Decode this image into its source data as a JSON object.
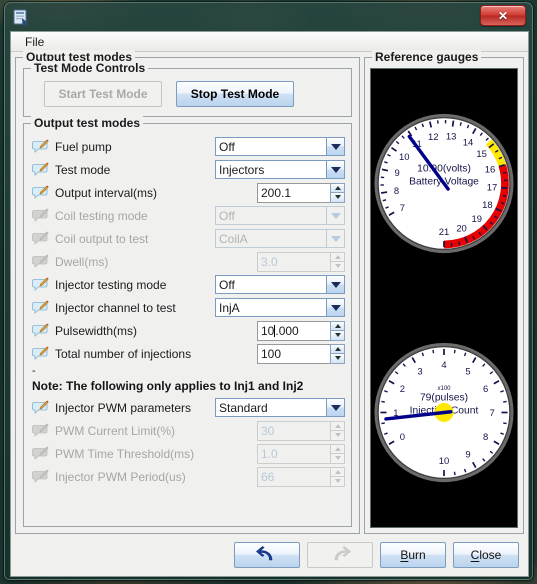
{
  "window": {
    "icon": "app-icon",
    "close_label": "✕"
  },
  "menubar": {
    "items": [
      {
        "label": "File"
      }
    ]
  },
  "outer_group": {
    "title": "Output test modes"
  },
  "controls_group": {
    "title": "Test Mode Controls",
    "start_label": "Start Test Mode",
    "stop_label": "Stop Test Mode"
  },
  "modes_group": {
    "title": "Output test modes",
    "rows": [
      {
        "icon": "edit-callout-icon",
        "label": "Fuel pump",
        "control": "combo",
        "value": "Off",
        "enabled": true
      },
      {
        "icon": "edit-callout-icon",
        "label": "Test mode",
        "control": "combo",
        "value": "Injectors",
        "enabled": true
      },
      {
        "icon": "edit-callout-icon",
        "label": "Output interval(ms)",
        "control": "spin",
        "value": "200.1",
        "enabled": true
      },
      {
        "icon": "edit-callout-icon",
        "label": "Coil testing mode",
        "control": "combo",
        "value": "Off",
        "enabled": false
      },
      {
        "icon": "edit-callout-icon",
        "label": "Coil output to test",
        "control": "combo",
        "value": "CoilA",
        "enabled": false
      },
      {
        "icon": "edit-callout-icon",
        "label": "Dwell(ms)",
        "control": "spin",
        "value": "3.0",
        "enabled": false
      },
      {
        "icon": "edit-callout-icon",
        "label": "Injector testing mode",
        "control": "combo",
        "value": "Off",
        "enabled": true
      },
      {
        "icon": "edit-callout-icon",
        "label": "Injector channel to test",
        "control": "combo",
        "value": "InjA",
        "enabled": true
      },
      {
        "icon": "edit-callout-icon",
        "label": "Pulsewidth(ms)",
        "control": "spin",
        "value": "10.000",
        "enabled": true,
        "caret_after": 2
      },
      {
        "icon": "edit-callout-icon",
        "label": "Total number of injections",
        "control": "spin",
        "value": "100",
        "enabled": true
      }
    ],
    "separator": "-",
    "note": "Note: The following only applies to Inj1 and Inj2",
    "pwm_rows": [
      {
        "icon": "edit-callout-icon",
        "label": "Injector PWM parameters",
        "control": "combo",
        "value": "Standard",
        "enabled": true
      },
      {
        "icon": "edit-callout-icon",
        "label": "PWM Current Limit(%)",
        "control": "spin",
        "value": "30",
        "enabled": false
      },
      {
        "icon": "edit-callout-icon",
        "label": "PWM Time Threshold(ms)",
        "control": "spin",
        "value": "1.0",
        "enabled": false
      },
      {
        "icon": "edit-callout-icon",
        "label": "Injector PWM Period(us)",
        "control": "spin",
        "value": "66",
        "enabled": false
      }
    ]
  },
  "gauges_group": {
    "title": "Reference gauges"
  },
  "chart_data": [
    {
      "type": "gauge",
      "name": "battery-voltage-gauge",
      "title": "Battery Voltage",
      "value_label": "10.90(volts)",
      "value": 10.9,
      "unit": "volts",
      "min": 7,
      "max": 21,
      "major_ticks": [
        7,
        8,
        9,
        10,
        11,
        12,
        13,
        14,
        15,
        16,
        17,
        18,
        19,
        20,
        21
      ],
      "minor_per_major": 2,
      "bands": [
        {
          "from": 14.8,
          "to": 16.0,
          "color": "#ffe800"
        },
        {
          "from": 16.0,
          "to": 21.0,
          "color": "#e60000"
        }
      ],
      "needle_color": "#00008b",
      "face_color": "#ffffff",
      "bezel_color": "#6b6b6b",
      "background": "#000000",
      "start_angle_deg": 210,
      "sweep_deg": 300
    },
    {
      "type": "gauge",
      "name": "injection-count-gauge",
      "title": "Injection Count",
      "value_label": "79(pulses)",
      "multiplier_label": "x100",
      "value": 0.79,
      "raw_value": 79,
      "unit": "pulses",
      "min": 0,
      "max": 10,
      "major_ticks": [
        0,
        1,
        2,
        3,
        4,
        5,
        6,
        7,
        8,
        9,
        10
      ],
      "minor_per_major": 2,
      "bands": [],
      "needle_color": "#00008b",
      "hub_color": "#ffe800",
      "face_color": "#ffffff",
      "bezel_color": "#6b6b6b",
      "background": "#000000",
      "start_angle_deg": 210,
      "sweep_deg": 300
    }
  ],
  "bottom_bar": {
    "buttons": [
      {
        "name": "undo-button",
        "icon": "undo-arrow-icon",
        "label": "",
        "enabled": true
      },
      {
        "name": "redo-button",
        "icon": "redo-arrow-icon",
        "label": "",
        "enabled": false
      },
      {
        "name": "burn-button",
        "icon": "",
        "label": "Burn",
        "mnemonic": "B",
        "enabled": true
      },
      {
        "name": "close-button",
        "icon": "",
        "label": "Close",
        "mnemonic": "C",
        "enabled": true
      }
    ]
  }
}
